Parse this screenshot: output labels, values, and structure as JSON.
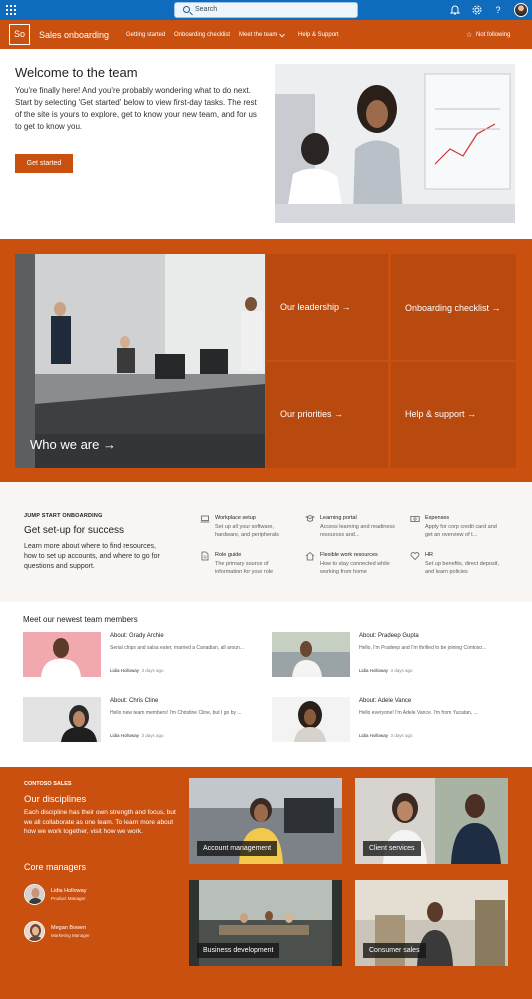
{
  "suite_bar": {
    "search_placeholder": "Search",
    "icons": [
      "waffle-icon",
      "bell-icon",
      "gear-icon",
      "help-icon",
      "avatar"
    ]
  },
  "site_header": {
    "logo": "So",
    "title": "Sales onboarding",
    "nav": [
      "Getting started",
      "Onboarding checklist",
      "Meet the team",
      "Help & Support"
    ],
    "nav_dropdown_index": 2,
    "follow": "Not following"
  },
  "hero": {
    "title": "Welcome to the team",
    "text": "You're finally here! And you're probably wondering what to do next. Start by selecting 'Get started' below to view first-day tasks. The rest of the site is yours to explore, get to know your new team, and for us to get to know you.",
    "button": "Get started"
  },
  "tiles": {
    "who": "Who we are →",
    "leadership": "Our leadership →",
    "checklist": "Onboarding checklist →",
    "priorities": "Our priorities →",
    "help": "Help & support →"
  },
  "jump": {
    "eyebrow": "JUMP START ONBOARDING",
    "title": "Get set-up for success",
    "text": "Learn more about where to find resources, how to set up accounts, and where to go for questions and support.",
    "links": [
      {
        "title": "Workplace setup",
        "desc": "Set up all your software, hardware, and peripherals",
        "icon": "laptop-icon"
      },
      {
        "title": "Learning portal",
        "desc": "Access learning and readiness resources and...",
        "icon": "learning-icon"
      },
      {
        "title": "Expenses",
        "desc": "Apply for corp credit card and get an overview of t...",
        "icon": "money-icon"
      },
      {
        "title": "Role guide",
        "desc": "The primary source of information for your role",
        "icon": "document-icon"
      },
      {
        "title": "Flexible work resources",
        "desc": "How to stay connected while working from home",
        "icon": "home-icon"
      },
      {
        "title": "HR",
        "desc": "Set up benefits, direct deposit, and learn policies",
        "icon": "heart-icon"
      }
    ]
  },
  "news": {
    "title": "Meet our newest team members",
    "items": [
      {
        "title": "About: Grady Archie",
        "snippet": "Serial chips and salsa eater, married a Canadian, all aroun...",
        "author": "Lidia Holloway",
        "date": "3 days ago"
      },
      {
        "title": "About: Pradeep Gupta",
        "snippet": "Hello, I'm Pradeep and I'm thrilled to be joining Contoso...",
        "author": "Lidia Holloway",
        "date": "3 days ago"
      },
      {
        "title": "About: Chris Cline",
        "snippet": "Hello new team members! I'm Christine Cline, but I go by ...",
        "author": "Lidia Holloway",
        "date": "3 days ago"
      },
      {
        "title": "About: Adele Vance",
        "snippet": "Hello everyone! I'm Adele Vance. I'm from Yucatan, ...",
        "author": "Lidia Holloway",
        "date": "3 days ago"
      }
    ]
  },
  "disciplines": {
    "eyebrow": "CONTOSO SALES",
    "title": "Our disciplines",
    "text": "Each discipline has their own strength and focus, but we all collaborate as one team. To learn more about how we work together, visit how we work.",
    "core_title": "Core managers",
    "managers": [
      {
        "name": "Lidia Holloway",
        "role": "Product Manager"
      },
      {
        "name": "Megan Bowen",
        "role": "Marketing Manager"
      }
    ],
    "tiles": [
      "Account management",
      "Client services",
      "Business development",
      "Consumer sales"
    ]
  },
  "colors": {
    "suite": "#0f6cbd",
    "accent": "#ca5010",
    "accent_dark": "#b84a0f",
    "soft_bg": "#f8f5f2"
  }
}
